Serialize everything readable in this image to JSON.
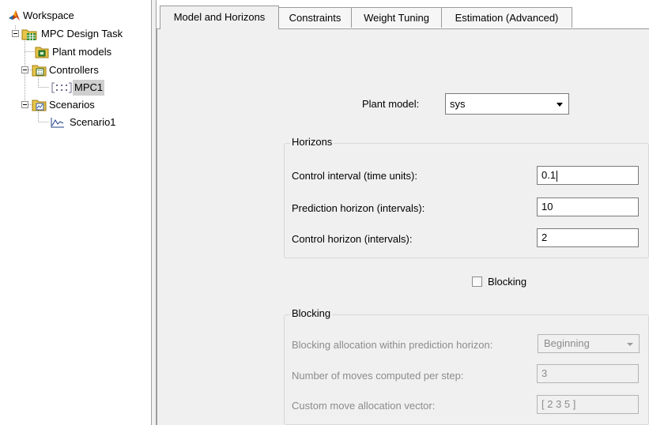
{
  "tree": {
    "root": {
      "label": "Workspace",
      "icon": "matlab-icon"
    },
    "task": {
      "label": "MPC Design Task",
      "icon": "task-grid-icon"
    },
    "plant_models": {
      "label": "Plant models",
      "icon": "plant-model-icon"
    },
    "controllers": {
      "label": "Controllers",
      "icon": "folder-icon"
    },
    "mpc1": {
      "label": "MPC1",
      "icon": "controller-matrix-icon"
    },
    "scenarios": {
      "label": "Scenarios",
      "icon": "folder-icon"
    },
    "scenario1": {
      "label": "Scenario1",
      "icon": "plot-icon"
    }
  },
  "tabs": [
    {
      "label": "Model and Horizons",
      "active": true
    },
    {
      "label": "Constraints",
      "active": false
    },
    {
      "label": "Weight Tuning",
      "active": false
    },
    {
      "label": "Estimation (Advanced)",
      "active": false
    }
  ],
  "plant": {
    "label": "Plant model:",
    "value": "sys"
  },
  "horizons": {
    "title": "Horizons",
    "control_interval": {
      "label": "Control interval (time units):",
      "value": "0.1"
    },
    "prediction_horizon": {
      "label": "Prediction horizon (intervals):",
      "value": "10"
    },
    "control_horizon": {
      "label": "Control horizon (intervals):",
      "value": "2"
    }
  },
  "blocking_checkbox": {
    "label": "Blocking",
    "checked": false
  },
  "blocking": {
    "title": "Blocking",
    "allocation": {
      "label": "Blocking allocation within prediction horizon:",
      "value": "Beginning"
    },
    "moves": {
      "label": "Number of moves computed per step:",
      "value": "3"
    },
    "custom": {
      "label": "Custom move allocation vector:",
      "value": "[ 2 3 5 ]"
    }
  },
  "colors": {
    "panel_background": "#f0f0f0",
    "selected_item": "#cfcfcf",
    "disabled_text": "#8c8c8c",
    "folder_yellow": "#e8c54a"
  }
}
